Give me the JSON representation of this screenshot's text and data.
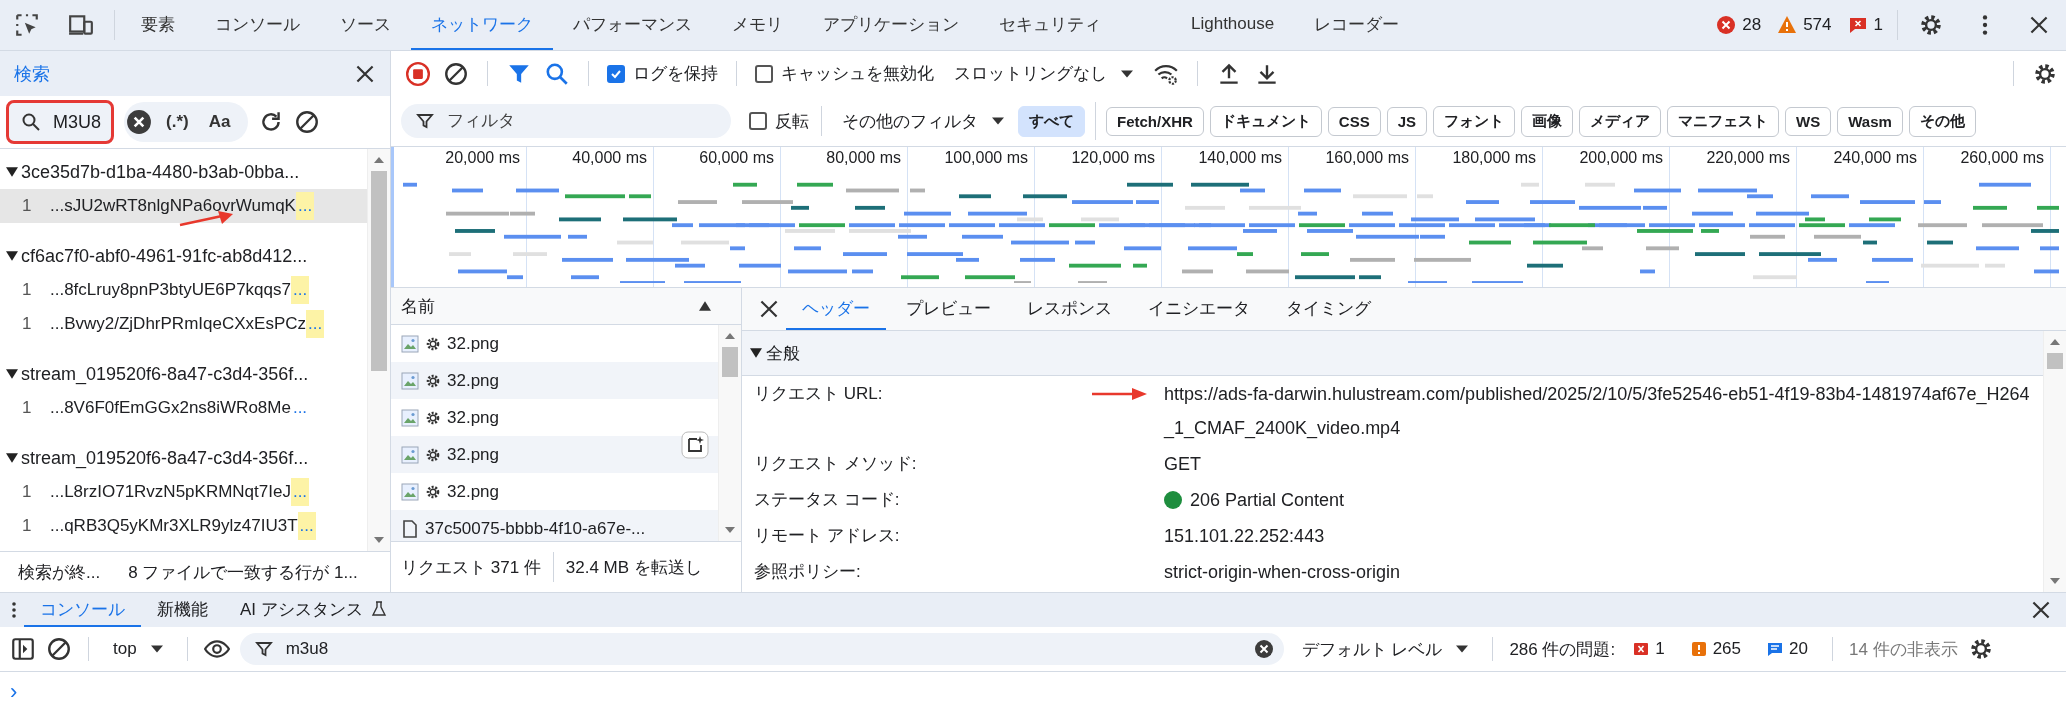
{
  "main_tabs": [
    {
      "label": "要素",
      "selected": false
    },
    {
      "label": "コンソール",
      "selected": false
    },
    {
      "label": "ソース",
      "selected": false
    },
    {
      "label": "ネットワーク",
      "selected": true
    },
    {
      "label": "パフォーマンス",
      "selected": false
    },
    {
      "label": "メモリ",
      "selected": false
    },
    {
      "label": "アプリケーション",
      "selected": false
    },
    {
      "label": "セキュリティ",
      "selected": false
    },
    {
      "label": "Lighthouse",
      "selected": false
    },
    {
      "label": "レコーダー",
      "selected": false
    }
  ],
  "top_counts": [
    {
      "kind": "error",
      "count": "28"
    },
    {
      "kind": "warning",
      "count": "574"
    },
    {
      "kind": "message",
      "count": "1"
    }
  ],
  "search_panel": {
    "title": "検索",
    "query": "M3U8",
    "regex_label": "(.*)",
    "case_label": "Aa",
    "results": [
      {
        "file": "3ce35d7b-d1ba-4480-b3ab-0bba...",
        "expanded": true,
        "children": [
          {
            "line": "1",
            "text": "...sJU2wRT8nlgNPa6ovrWumqK",
            "more": "...",
            "highlighted": true,
            "selected": true
          }
        ]
      },
      {
        "file": "cf6ac7f0-abf0-4961-91fc-ab8d412...",
        "expanded": true,
        "children": [
          {
            "line": "1",
            "text": "...8fcLruy8pnP3btyUE6P7kqqs7",
            "more": "...",
            "highlighted": true,
            "selected": false
          },
          {
            "line": "1",
            "text": "...Bvwy2/ZjDhrPRmIqeCXxEsPCz",
            "more": "...",
            "highlighted": true,
            "selected": false
          }
        ]
      },
      {
        "file": "stream_019520f6-8a47-c3d4-356f...",
        "expanded": true,
        "children": [
          {
            "line": "1",
            "text": "...8V6F0fEmGGx2ns8iWRo8Me",
            "more": "...",
            "highlighted": false,
            "selected": false
          }
        ]
      },
      {
        "file": "stream_019520f6-8a47-c3d4-356f...",
        "expanded": true,
        "children": [
          {
            "line": "1",
            "text": "...L8rzIO71RvzN5pKRMNqt7IeJ",
            "more": "...",
            "highlighted": true,
            "selected": false
          },
          {
            "line": "1",
            "text": "...qRB3Q5yKMr3XLR9ylz47IU3T",
            "more": "...",
            "highlighted": true,
            "selected": false
          }
        ]
      }
    ],
    "status": "検索が終...",
    "summary": "8 ファイルで一致する行が 1..."
  },
  "network_toolbar": {
    "recording": true,
    "preserve_log": {
      "label": "ログを保持",
      "checked": true
    },
    "disable_cache": {
      "label": "キャッシュを無効化",
      "checked": false
    },
    "throttling": "スロットリングなし"
  },
  "filter_bar": {
    "placeholder": "フィルタ",
    "invert": {
      "label": "反転",
      "checked": false
    },
    "more_filters": "その他のフィルタ",
    "types": [
      {
        "label": "すべて",
        "selected": true
      },
      {
        "label": "Fetch/XHR",
        "selected": false
      },
      {
        "label": "ドキュメント",
        "selected": false
      },
      {
        "label": "CSS",
        "selected": false
      },
      {
        "label": "JS",
        "selected": false
      },
      {
        "label": "フォント",
        "selected": false
      },
      {
        "label": "画像",
        "selected": false
      },
      {
        "label": "メディア",
        "selected": false
      },
      {
        "label": "マニフェスト",
        "selected": false
      },
      {
        "label": "WS",
        "selected": false
      },
      {
        "label": "Wasm",
        "selected": false
      },
      {
        "label": "その他",
        "selected": false
      }
    ]
  },
  "timeline": {
    "ticks": [
      "20,000 ms",
      "40,000 ms",
      "60,000 ms",
      "80,000 ms",
      "100,000 ms",
      "120,000 ms",
      "140,000 ms",
      "160,000 ms",
      "180,000 ms",
      "200,000 ms",
      "220,000 ms",
      "240,000 ms",
      "260,000 ms"
    ]
  },
  "request_list": {
    "column": "名前",
    "rows": [
      {
        "name": "32.png",
        "kind": "image",
        "service_worker": true
      },
      {
        "name": "32.png",
        "kind": "image",
        "service_worker": true
      },
      {
        "name": "32.png",
        "kind": "image",
        "service_worker": true
      },
      {
        "name": "32.png",
        "kind": "image",
        "service_worker": true
      },
      {
        "name": "32.png",
        "kind": "image",
        "service_worker": true
      },
      {
        "name": "37c50075-bbbb-4f10-a67e-...",
        "kind": "document",
        "service_worker": false
      }
    ],
    "requests": "リクエスト 371 件",
    "transferred": "32.4 MB を転送し"
  },
  "details": {
    "tabs": [
      {
        "label": "ヘッダー",
        "selected": true
      },
      {
        "label": "プレビュー",
        "selected": false
      },
      {
        "label": "レスポンス",
        "selected": false
      },
      {
        "label": "イニシエータ",
        "selected": false
      },
      {
        "label": "タイミング",
        "selected": false
      }
    ],
    "section": {
      "title": "全般",
      "expanded": true,
      "rows": [
        {
          "key": "リクエスト URL:",
          "value": "https://ads-fa-darwin.hulustream.com/published/2025/2/10/5/3fe52546-eb51-4f19-83b4-1481974af67e_H264_1_CMAF_2400K_video.mp4"
        },
        {
          "key": "リクエスト メソッド:",
          "value": "GET"
        },
        {
          "key": "ステータス コード:",
          "value": "206 Partial Content",
          "color": "#1e8e3e"
        },
        {
          "key": "リモート アドレス:",
          "value": "151.101.22.252:443"
        },
        {
          "key": "参照ポリシー:",
          "value": "strict-origin-when-cross-origin"
        }
      ]
    }
  },
  "drawer": {
    "tabs": [
      {
        "label": "コンソール",
        "selected": true
      },
      {
        "label": "新機能",
        "selected": false
      },
      {
        "label": "AI アシスタンス",
        "selected": false
      }
    ],
    "context": "top",
    "filter_value": "m3u8",
    "levels": "デフォルト レベル",
    "issues_label": "286 件の問題:",
    "issue_counts": [
      {
        "kind": "error",
        "count": "1"
      },
      {
        "kind": "warning",
        "count": "265"
      },
      {
        "kind": "info",
        "count": "20"
      }
    ],
    "hidden": "14 件の非表示",
    "prompt": "›"
  }
}
